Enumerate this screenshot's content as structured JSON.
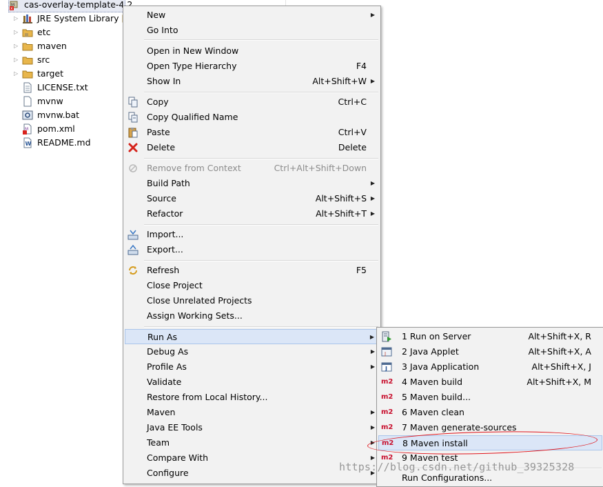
{
  "tree": {
    "root_label": "cas-overlay-template-4.2",
    "items": [
      {
        "label": "JRE System Library",
        "decoration": "[J",
        "icon": "library-icon"
      },
      {
        "label": "etc",
        "icon": "folder-icon"
      },
      {
        "label": "maven",
        "icon": "folder-icon"
      },
      {
        "label": "src",
        "icon": "folder-icon"
      },
      {
        "label": "target",
        "icon": "folder-icon"
      },
      {
        "label": "LICENSE.txt",
        "icon": "text-file-icon"
      },
      {
        "label": "mvnw",
        "icon": "file-icon"
      },
      {
        "label": "mvnw.bat",
        "icon": "batch-file-icon"
      },
      {
        "label": "pom.xml",
        "icon": "xml-file-icon"
      },
      {
        "label": "README.md",
        "icon": "document-file-icon"
      }
    ]
  },
  "menu": {
    "items": [
      {
        "label": "New"
      },
      {
        "label": "Go Into"
      },
      {
        "label": "Open in New Window"
      },
      {
        "label": "Open Type Hierarchy",
        "shortcut": "F4"
      },
      {
        "label": "Show In",
        "shortcut": "Alt+Shift+W"
      },
      {
        "label": "Copy",
        "shortcut": "Ctrl+C",
        "icon": "copy-icon"
      },
      {
        "label": "Copy Qualified Name",
        "icon": "copy-qualified-icon"
      },
      {
        "label": "Paste",
        "shortcut": "Ctrl+V",
        "icon": "paste-icon"
      },
      {
        "label": "Delete",
        "shortcut": "Delete",
        "icon": "delete-icon"
      },
      {
        "label": "Remove from Context",
        "shortcut": "Ctrl+Alt+Shift+Down",
        "icon": "remove-context-icon"
      },
      {
        "label": "Build Path"
      },
      {
        "label": "Source",
        "shortcut": "Alt+Shift+S"
      },
      {
        "label": "Refactor",
        "shortcut": "Alt+Shift+T"
      },
      {
        "label": "Import...",
        "icon": "import-icon"
      },
      {
        "label": "Export...",
        "icon": "export-icon"
      },
      {
        "label": "Refresh",
        "shortcut": "F5",
        "icon": "refresh-icon"
      },
      {
        "label": "Close Project"
      },
      {
        "label": "Close Unrelated Projects"
      },
      {
        "label": "Assign Working Sets..."
      },
      {
        "label": "Run As"
      },
      {
        "label": "Debug As"
      },
      {
        "label": "Profile As"
      },
      {
        "label": "Validate"
      },
      {
        "label": "Restore from Local History..."
      },
      {
        "label": "Maven"
      },
      {
        "label": "Java EE Tools"
      },
      {
        "label": "Team"
      },
      {
        "label": "Compare With"
      },
      {
        "label": "Configure"
      }
    ]
  },
  "submenu": {
    "items": [
      {
        "label": "1 Run on Server",
        "shortcut": "Alt+Shift+X, R",
        "icon": "run-on-server-icon"
      },
      {
        "label": "2 Java Applet",
        "shortcut": "Alt+Shift+X, A",
        "icon": "java-applet-icon"
      },
      {
        "label": "3 Java Application",
        "shortcut": "Alt+Shift+X, J",
        "icon": "java-application-icon"
      },
      {
        "label": "4 Maven build",
        "shortcut": "Alt+Shift+X, M",
        "icon": "m2-icon"
      },
      {
        "label": "5 Maven build...",
        "icon": "m2-icon"
      },
      {
        "label": "6 Maven clean",
        "icon": "m2-icon"
      },
      {
        "label": "7 Maven generate-sources",
        "icon": "m2-icon"
      },
      {
        "label": "8 Maven install",
        "icon": "m2-icon"
      },
      {
        "label": "9 Maven test",
        "icon": "m2-icon"
      },
      {
        "label": "Run Configurations..."
      }
    ],
    "m2_text": "m2"
  },
  "watermark": "https://blog.csdn.net/github_39325328",
  "colors": {
    "menu_bg": "#f2f2f2",
    "highlight": "#dbe6f7",
    "annotation": "#e0131a",
    "m2_red": "#c8102e"
  }
}
